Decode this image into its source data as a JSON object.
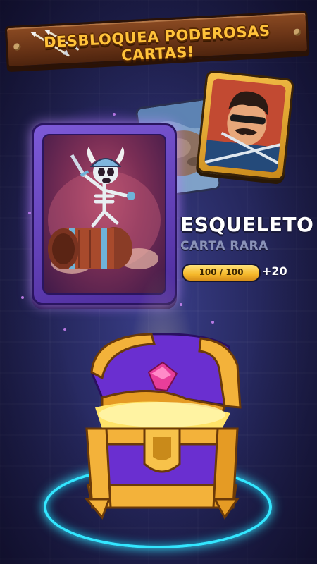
{
  "banner": {
    "title": "DESBLOQUEA PODEROSAS CARTAS!"
  },
  "card": {
    "name": "ESQUELETO",
    "rarity": "CARTA RARA",
    "progress_text": "100 / 100",
    "progress_fraction": 1.0,
    "bonus": "+20"
  },
  "colors": {
    "banner_text": "#ffc23a",
    "card_frame": "#7d5ad8",
    "progress_fill": "#f5b82a",
    "ring": "#33e6ff",
    "chest_gold": "#f3b23a",
    "chest_purple": "#6a2fd0"
  },
  "icons": [
    "arrows-icon",
    "gem-icon",
    "lock-icon",
    "skeleton-icon",
    "barrel-icon"
  ]
}
